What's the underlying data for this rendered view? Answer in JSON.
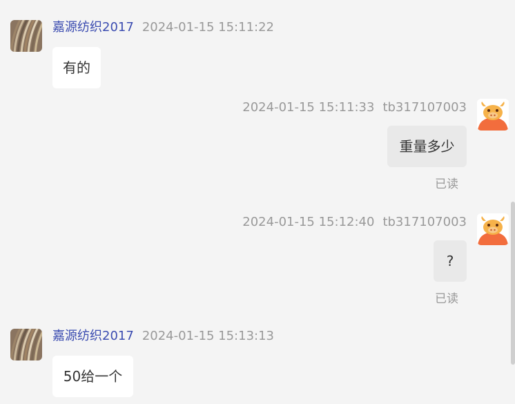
{
  "messages": [
    {
      "direction": "incoming",
      "sender": "嘉源纺织2017",
      "timestamp": "2024-01-15 15:11:22",
      "text": "有的"
    },
    {
      "direction": "outgoing",
      "sender": "tb317107003",
      "timestamp": "2024-01-15 15:11:33",
      "text": "重量多少",
      "status": "已读"
    },
    {
      "direction": "outgoing",
      "sender": "tb317107003",
      "timestamp": "2024-01-15 15:12:40",
      "text": "?",
      "status": "已读"
    },
    {
      "direction": "incoming",
      "sender": "嘉源纺织2017",
      "timestamp": "2024-01-15 15:13:13",
      "text": "50给一个"
    }
  ],
  "icons": {
    "incoming_avatar": "fabric-rolls-avatar",
    "outgoing_avatar": "cartoon-bull-avatar"
  },
  "colors": {
    "background": "#f4f4f4",
    "incoming_bubble": "#ffffff",
    "outgoing_bubble": "#e9e9e9",
    "sender_name": "#3a4bb0",
    "meta_text": "#999999",
    "message_text": "#333333",
    "bull_orange": "#f26d3d"
  }
}
